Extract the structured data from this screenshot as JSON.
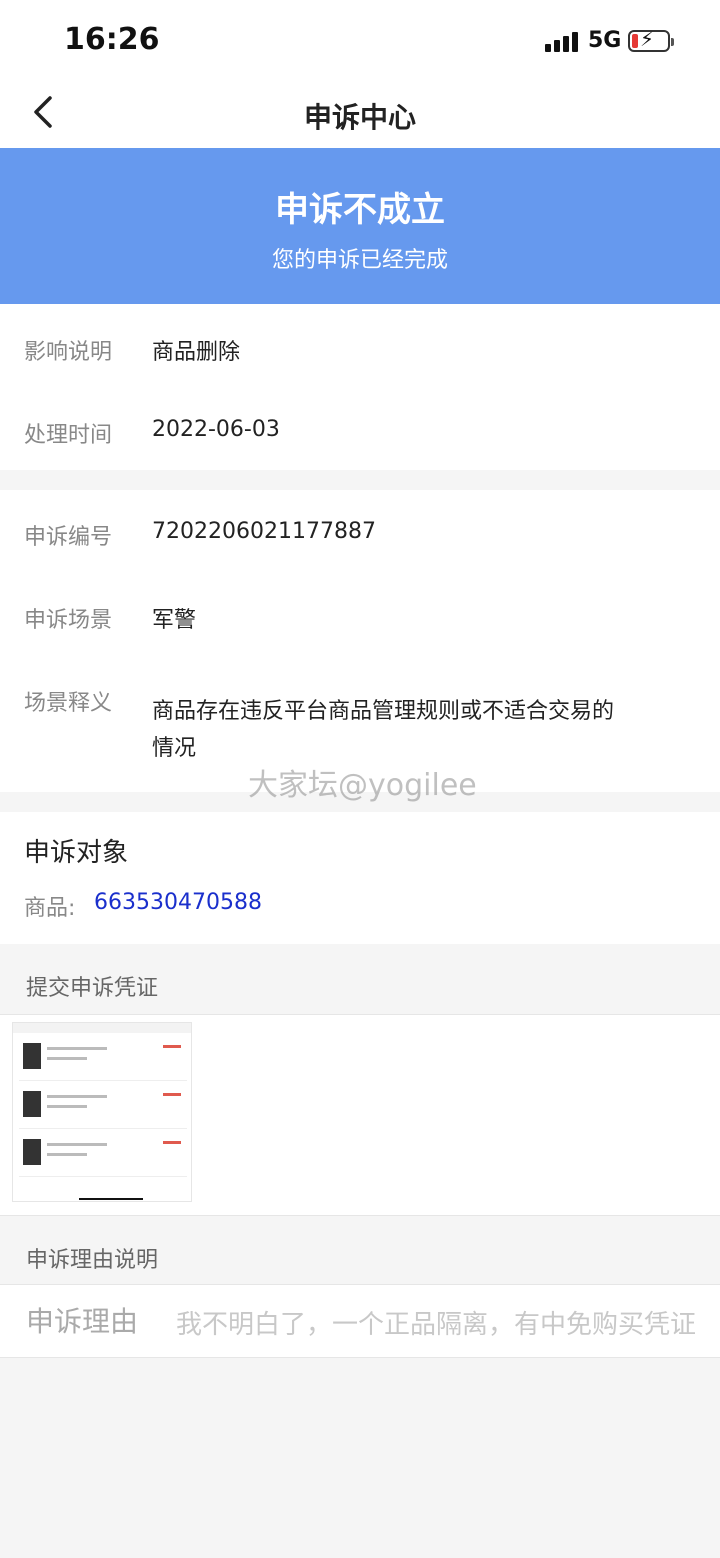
{
  "status_bar": {
    "time": "16:26",
    "network": "5G",
    "bolt": "⚡"
  },
  "nav": {
    "title": "申诉中心"
  },
  "banner": {
    "title": "申诉不成立",
    "subtitle": "您的申诉已经完成"
  },
  "info": [
    {
      "label": "影响说明",
      "value": "商品删除"
    },
    {
      "label": "处理时间",
      "value": "2022-06-03"
    }
  ],
  "details": [
    {
      "label": "申诉编号",
      "value": "7202206021177887"
    },
    {
      "label": "申诉场景",
      "value": "军警"
    },
    {
      "label": "场景释义",
      "value_line1": "商品存在违反平台商品管理规则或不适合交易的",
      "value_line2": "情况"
    }
  ],
  "object": {
    "title": "申诉对象",
    "label": "商品:",
    "value": "663530470588"
  },
  "evidence": {
    "title": "提交申诉凭证"
  },
  "reason": {
    "section_title": "申诉理由说明",
    "label": "申诉理由",
    "text": "我不明白了，一个正品隔离，有中免购买凭证"
  },
  "watermark": "大家坛@yogilee",
  "colors": {
    "banner": "#6699ee",
    "link": "#1a2fcc"
  },
  "icons": {
    "back": "chevron-left-icon"
  }
}
